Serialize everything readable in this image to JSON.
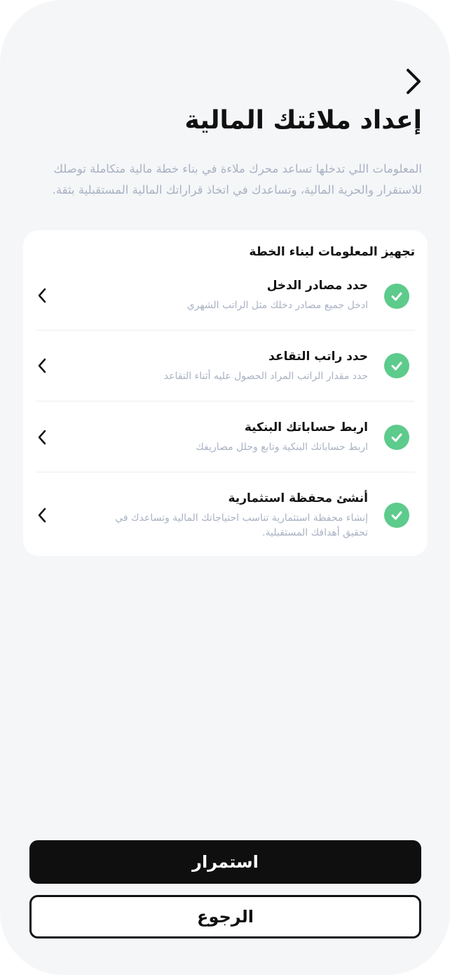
{
  "header": {
    "back_icon": "chevron-right-icon",
    "title": "إعداد ملائتك المالية",
    "description": "المعلومات اللي تدخلها تساعد محرك ملاءة في بناء خطة مالية متكاملة توصلك للاستقرار والحرية المالية، وتساعدك في اتخاذ قراراتك المالية المستقبلية بثقة."
  },
  "card": {
    "title": "تجهيز المعلومات لبناء الخطة",
    "items": [
      {
        "title": "حدد مصادر الدخل",
        "subtitle": "ادخل جميع مصادر دخلك مثل الراتب الشهري",
        "status_icon": "check-circle-icon",
        "nav_icon": "chevron-left-icon"
      },
      {
        "title": "حدد راتب التقاعد",
        "subtitle": "حدد مقدار الراتب المراد الحصول عليه أثناء التقاعد",
        "status_icon": "check-circle-icon",
        "nav_icon": "chevron-left-icon"
      },
      {
        "title": "اربط حساباتك البنكية",
        "subtitle": "اربط حساباتك البنكية وتابع وحلل مصاريفك",
        "status_icon": "check-circle-icon",
        "nav_icon": "chevron-left-icon"
      },
      {
        "title": "أنشئ محفظة استثمارية",
        "subtitle": "إنشاء محفظة استثمارية تناسب احتياجاتك المالية وتساعدك في تحقيق أهدافك المستقبلية.",
        "status_icon": "check-circle-icon",
        "nav_icon": "chevron-left-icon"
      }
    ]
  },
  "actions": {
    "continue_label": "استمرار",
    "back_label": "الرجوع"
  },
  "colors": {
    "background": "#f5f6f8",
    "card": "#ffffff",
    "check_green": "#5ccb8b",
    "muted_text": "#a9b2c3",
    "primary_button": "#0f0f10"
  }
}
